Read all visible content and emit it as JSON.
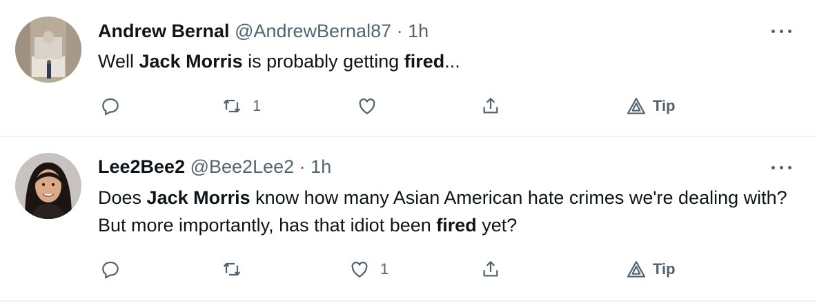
{
  "tweets": [
    {
      "name": "Andrew Bernal",
      "handle": "@AndrewBernal87",
      "separator": "·",
      "time": "1h",
      "text_parts": [
        "Well ",
        "Jack Morris",
        " is probably getting ",
        "fired",
        "..."
      ],
      "reply_count": "",
      "retweet_count": "1",
      "like_count": "",
      "tip_label": "Tip"
    },
    {
      "name": "Lee2Bee2",
      "handle": "@Bee2Lee2",
      "separator": "·",
      "time": "1h",
      "text_parts": [
        "Does ",
        "Jack Morris",
        " know how many Asian American hate crimes we're dealing with? But more importantly, has that idiot been ",
        "fired",
        " yet?"
      ],
      "reply_count": "",
      "retweet_count": "",
      "like_count": "1",
      "tip_label": "Tip"
    }
  ],
  "icons": {
    "more": "more-options-icon",
    "reply": "reply-icon",
    "retweet": "retweet-icon",
    "like": "like-heart-icon",
    "share": "share-icon",
    "tip": "tip-icon"
  },
  "colors": {
    "text": "#0f1419",
    "secondary": "#536471",
    "divider": "#eff3f4"
  }
}
